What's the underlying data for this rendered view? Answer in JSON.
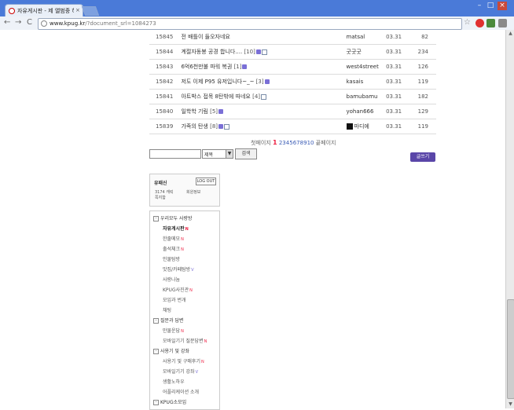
{
  "browser": {
    "tab_title": "자유게시판 - 제 앨범중 하",
    "tab_close": "×",
    "url_host": "www.kpug.kr",
    "url_path": "/?document_srl=1084273",
    "win_min": "–",
    "win_max": "□",
    "win_close": "×",
    "back": "←",
    "forward": "→",
    "reload": "C",
    "star": "☆"
  },
  "posts": [
    {
      "num": "15845",
      "subject": "전 배틀이 들오자네요",
      "comments": "",
      "author": "matsal",
      "date": "03.31",
      "hits": "82",
      "new": false,
      "file": false
    },
    {
      "num": "15844",
      "subject": "계절자동봉 공경 합니다....",
      "comments": "[10]",
      "author": "굿굿굿",
      "date": "03.31",
      "hits": "234",
      "new": true,
      "file": true
    },
    {
      "num": "15843",
      "subject": "6억6천만불 파워 복권",
      "comments": "[1]",
      "author": "west4street",
      "date": "03.31",
      "hits": "126",
      "new": true,
      "file": false
    },
    {
      "num": "15842",
      "subject": "저도 이제 P95 유저입니다~_~",
      "comments": "[3]",
      "author": "kasais",
      "date": "03.31",
      "hits": "119",
      "new": true,
      "file": false
    },
    {
      "num": "15841",
      "subject": "아트박스 접목 8탄밖에 따네요",
      "comments": "[4]",
      "author": "bamubamu",
      "date": "03.31",
      "hits": "182",
      "new": false,
      "file": true
    },
    {
      "num": "15840",
      "subject": "일학학 기림",
      "comments": "[5]",
      "author": "yohan666",
      "date": "03.31",
      "hits": "129",
      "new": true,
      "file": false
    },
    {
      "num": "15839",
      "subject": "가족의 탄생",
      "comments": "[8]",
      "author": "마디에",
      "date": "03.31",
      "hits": "119",
      "new": true,
      "file": true
    }
  ],
  "pager": {
    "prev": "첫페이지",
    "current": "1",
    "pages": [
      "2",
      "3",
      "4",
      "5",
      "6",
      "7",
      "8",
      "9",
      "10"
    ],
    "next": "끝페이지"
  },
  "search": {
    "select_value": "제목",
    "button": "검색"
  },
  "write_button": "글쓰기",
  "login": {
    "name": "유패신",
    "logout": "LOG OUT",
    "links": [
      "3174 캐릭",
      "회원정보",
      "쪽지함"
    ]
  },
  "menu": [
    {
      "label": "우리모두 사랑방",
      "type": "group",
      "badge": ""
    },
    {
      "label": "자유게시판",
      "type": "sub",
      "badge": "N",
      "active": true
    },
    {
      "label": "한줄메모",
      "type": "sub",
      "badge": "N"
    },
    {
      "label": "출석체크",
      "type": "sub",
      "badge": "N"
    },
    {
      "label": "인물탐방",
      "type": "sub",
      "badge": ""
    },
    {
      "label": "맛집/카페탐방",
      "type": "sub",
      "badge": "V"
    },
    {
      "label": "사랑나눔",
      "type": "sub",
      "badge": ""
    },
    {
      "label": "KPUG사진관",
      "type": "sub",
      "badge": "N"
    },
    {
      "label": "모임과 번개",
      "type": "sub",
      "badge": ""
    },
    {
      "label": "채팅",
      "type": "sub",
      "badge": ""
    },
    {
      "label": "질문과 답변",
      "type": "group",
      "badge": ""
    },
    {
      "label": "만물운답",
      "type": "sub",
      "badge": "N"
    },
    {
      "label": "모바일기기 질문답변",
      "type": "sub",
      "badge": "N"
    },
    {
      "label": "사용기 및 강좌",
      "type": "group",
      "badge": ""
    },
    {
      "label": "사용기 및 구매후기",
      "type": "sub",
      "badge": "N"
    },
    {
      "label": "모바일기기 강좌",
      "type": "sub",
      "badge": "V"
    },
    {
      "label": "생활노하우",
      "type": "sub",
      "badge": ""
    },
    {
      "label": "어플리케이션 소개",
      "type": "sub",
      "badge": ""
    },
    {
      "label": "KPUG소모임",
      "type": "group",
      "badge": ""
    }
  ]
}
